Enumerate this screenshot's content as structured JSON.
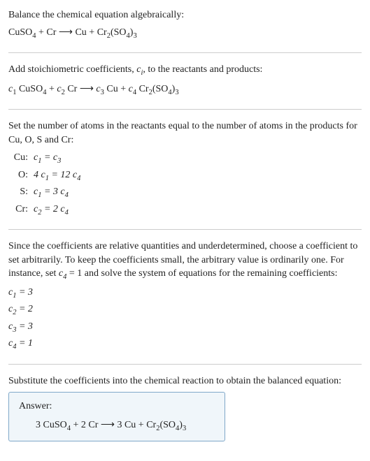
{
  "intro": {
    "line1": "Balance the chemical equation algebraically:"
  },
  "step2": {
    "text": "Add stoichiometric coefficients, ",
    "text2": ", to the reactants and products:"
  },
  "step3": {
    "text": "Set the number of atoms in the reactants equal to the number of atoms in the products for Cu, O, S and Cr:"
  },
  "atoms": {
    "rows": [
      {
        "label": "Cu:",
        "lhs": "c",
        "lsub": "1",
        "rhs": "c",
        "rsub": "3",
        "mult": "",
        "rmult": ""
      },
      {
        "label": "O:",
        "lhs": "4 c",
        "lsub": "1",
        "rhs": "12 c",
        "rsub": "4"
      },
      {
        "label": "S:",
        "lhs": "c",
        "lsub": "1",
        "rhs": "3 c",
        "rsub": "4"
      },
      {
        "label": "Cr:",
        "lhs": "c",
        "lsub": "2",
        "rhs": "2 c",
        "rsub": "4"
      }
    ]
  },
  "step4": {
    "text1": "Since the coefficients are relative quantities and underdetermined, choose a coefficient to set arbitrarily. To keep the coefficients small, the arbitrary value is ordinarily one. For instance, set ",
    "text2": " = 1 and solve the system of equations for the remaining coefficients:"
  },
  "coeffs": [
    {
      "var": "c",
      "sub": "1",
      "val": " = 3"
    },
    {
      "var": "c",
      "sub": "2",
      "val": " = 2"
    },
    {
      "var": "c",
      "sub": "3",
      "val": " = 3"
    },
    {
      "var": "c",
      "sub": "4",
      "val": " = 1"
    }
  ],
  "step5": {
    "text": "Substitute the coefficients into the chemical reaction to obtain the balanced equation:"
  },
  "answer": {
    "label": "Answer:"
  },
  "chart_data": {
    "type": "table",
    "title": "Balancing chemical equation CuSO4 + Cr -> Cu + Cr2(SO4)3",
    "unbalanced_equation": "CuSO4 + Cr ⟶ Cu + Cr2(SO4)3",
    "coefficient_equation": "c1 CuSO4 + c2 Cr ⟶ c3 Cu + c4 Cr2(SO4)3",
    "atom_balance_equations": [
      {
        "element": "Cu",
        "equation": "c1 = c3"
      },
      {
        "element": "O",
        "equation": "4 c1 = 12 c4"
      },
      {
        "element": "S",
        "equation": "c1 = 3 c4"
      },
      {
        "element": "Cr",
        "equation": "c2 = 2 c4"
      }
    ],
    "arbitrary_set": "c4 = 1",
    "solved_coefficients": {
      "c1": 3,
      "c2": 2,
      "c3": 3,
      "c4": 1
    },
    "balanced_equation": "3 CuSO4 + 2 Cr ⟶ 3 Cu + Cr2(SO4)3"
  }
}
